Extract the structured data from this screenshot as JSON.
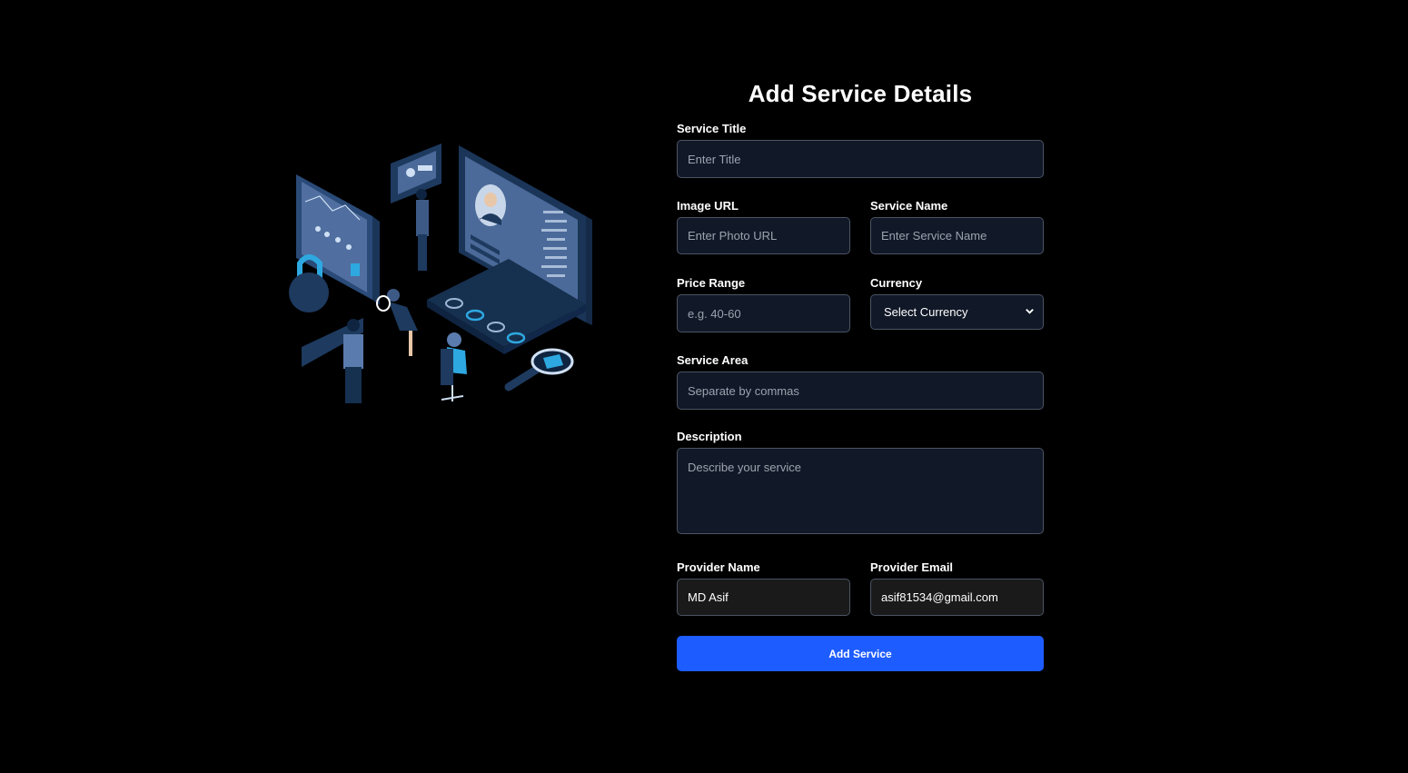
{
  "form": {
    "title": "Add Service Details",
    "service_title": {
      "label": "Service Title",
      "placeholder": "Enter Title",
      "value": ""
    },
    "image_url": {
      "label": "Image URL",
      "placeholder": "Enter Photo URL",
      "value": ""
    },
    "service_name": {
      "label": "Service Name",
      "placeholder": "Enter Service Name",
      "value": ""
    },
    "price_range": {
      "label": "Price Range",
      "placeholder": "e.g. 40-60",
      "value": ""
    },
    "currency": {
      "label": "Currency",
      "selected": "Select Currency"
    },
    "service_area": {
      "label": "Service Area",
      "placeholder": "Separate by commas",
      "value": ""
    },
    "description": {
      "label": "Description",
      "placeholder": "Describe your service",
      "value": ""
    },
    "provider_name": {
      "label": "Provider Name",
      "value": "MD Asif"
    },
    "provider_email": {
      "label": "Provider Email",
      "value": "asif81534@gmail.com"
    },
    "submit_label": "Add Service"
  },
  "colors": {
    "background": "#000000",
    "input_bg": "#111827",
    "accent": "#1d5cff",
    "illustration_primary": "#1e3a5f",
    "illustration_highlight": "#2ea8e0"
  },
  "illustration": {
    "icon": "security-dashboard-illustration"
  }
}
